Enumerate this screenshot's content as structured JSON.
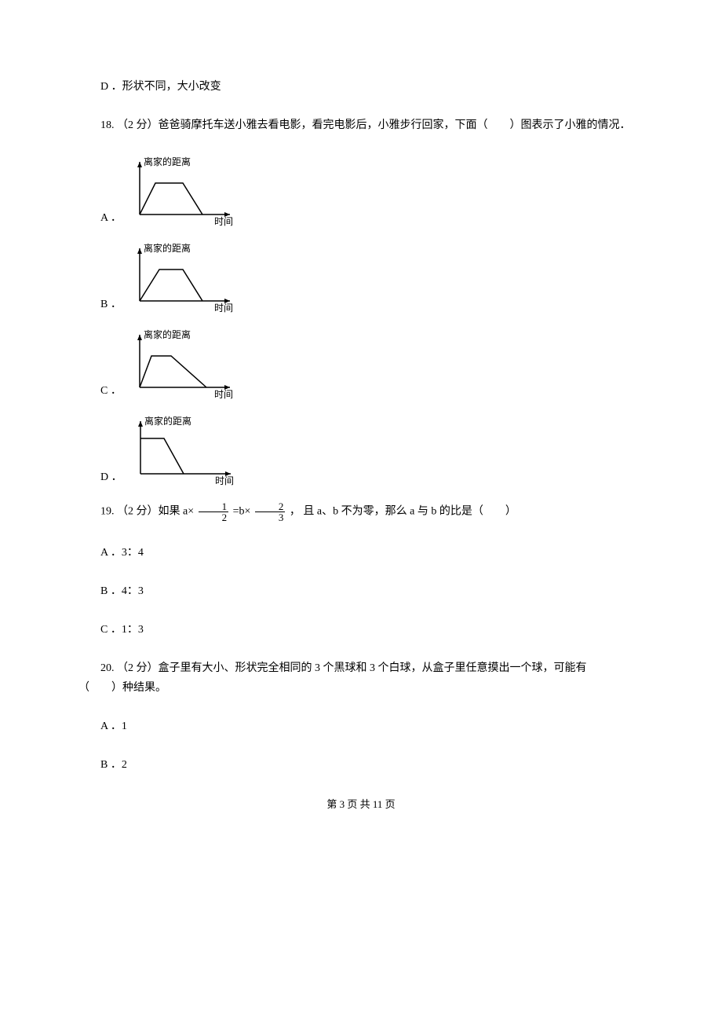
{
  "q17": {
    "optionD": "D ．形状不同，大小改变"
  },
  "q18": {
    "stem": "18.  （2 分）爸爸骑摩托车送小雅去看电影，看完电影后，小雅步行回家，下面（　　）图表示了小雅的情况．",
    "stem_line2": "的情况．",
    "axis_y_label": "离家的距离",
    "axis_x_label": "时间",
    "options": {
      "A": "A ．",
      "B": "B ．",
      "C": "C ．",
      "D": "D ．"
    }
  },
  "q19": {
    "stem_prefix": "19.  （2 分）如果 a× ",
    "frac1_num": "1",
    "frac1_den": "2",
    "stem_mid": " =b× ",
    "frac2_num": "2",
    "frac2_den": "3",
    "stem_suffix": " ， 且 a、b 不为零，那么 a 与 b 的比是（　　）",
    "optionA": "A ．3：4",
    "optionB": "B ．4：3",
    "optionC": "C ．1：3"
  },
  "q20": {
    "stem": "20.  （2 分）盒子里有大小、形状完全相同的 3 个黑球和 3 个白球，从盒子里任意摸出一个球，可能有",
    "stem_line2": "（　　）种结果。",
    "optionA": "A ．1",
    "optionB": "B ．2"
  },
  "footer": "第 3 页 共 11 页",
  "chart_data": [
    {
      "type": "line",
      "title": "",
      "xlabel": "时间",
      "ylabel": "离家的距离",
      "series": [
        {
          "name": "A",
          "x": [
            0,
            20,
            55,
            80
          ],
          "y": [
            0,
            40,
            40,
            0
          ]
        }
      ],
      "rise_slope_steep": true,
      "fall_slope_steep": true
    },
    {
      "type": "line",
      "title": "",
      "xlabel": "时间",
      "ylabel": "离家的距离",
      "series": [
        {
          "name": "B",
          "x": [
            0,
            25,
            55,
            80
          ],
          "y": [
            0,
            40,
            40,
            0
          ]
        }
      ],
      "rise_slope_steep": true,
      "fall_slope_steep": true
    },
    {
      "type": "line",
      "title": "",
      "xlabel": "时间",
      "ylabel": "离家的距离",
      "series": [
        {
          "name": "C",
          "x": [
            0,
            15,
            40,
            85
          ],
          "y": [
            0,
            40,
            40,
            0
          ]
        }
      ],
      "rise_slope_steep": true,
      "fall_slope_gentle": true
    },
    {
      "type": "line",
      "title": "",
      "xlabel": "时间",
      "ylabel": "离家的距离",
      "series": [
        {
          "name": "D",
          "x": [
            0,
            0,
            30,
            55
          ],
          "y": [
            0,
            40,
            40,
            0
          ]
        }
      ],
      "note": "starts at top (already at distance), plateau, then steep decline"
    }
  ]
}
